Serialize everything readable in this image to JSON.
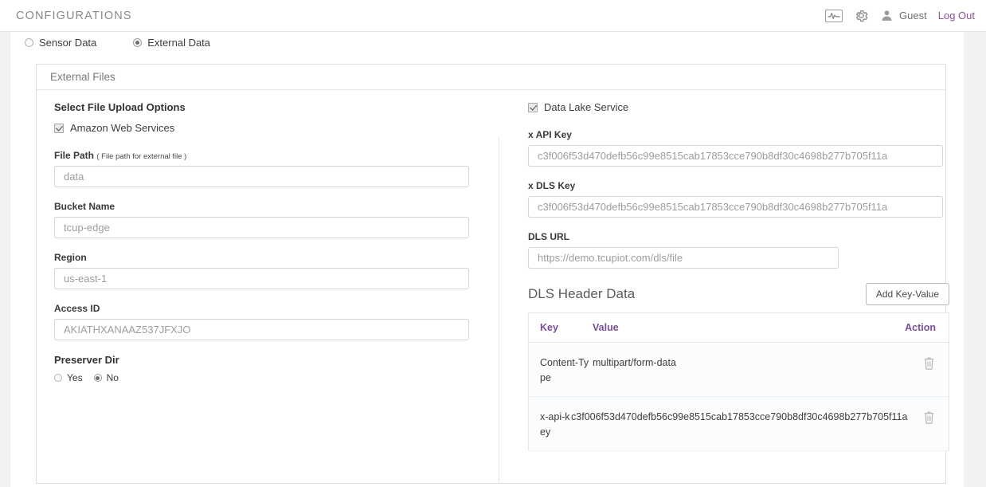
{
  "header": {
    "app_title": "CONFIGURATIONS",
    "monitor_icon": "monitor-waveform-icon",
    "gear_icon": "gear-icon",
    "avatar_icon": "user-avatar-icon",
    "user_name": "Guest",
    "logout_label": "Log Out",
    "logout_color": "#8b4f9e"
  },
  "data_source": {
    "options": [
      {
        "label": "Sensor Data",
        "selected": false
      },
      {
        "label": "External Data",
        "selected": true
      }
    ]
  },
  "card": {
    "title": "External Files"
  },
  "left": {
    "section_title": "Select File Upload Options",
    "aws_checkbox": {
      "label": "Amazon Web Services",
      "checked": true
    },
    "fields": [
      {
        "label": "File Path",
        "hint": "( File path for external file )",
        "value": "data"
      },
      {
        "label": "Bucket Name",
        "hint": "",
        "value": "tcup-edge"
      },
      {
        "label": "Region",
        "hint": "",
        "value": "us-east-1"
      },
      {
        "label": "Access ID",
        "hint": "",
        "value": "AKIATHXANAAZ537JFXJO"
      }
    ],
    "preserve_dir": {
      "label": "Preserver Dir",
      "options": [
        {
          "label": "Yes",
          "selected": false
        },
        {
          "label": "No",
          "selected": true
        }
      ]
    }
  },
  "right": {
    "dls_checkbox": {
      "label": "Data Lake Service",
      "checked": true
    },
    "fields": [
      {
        "label": "x API Key",
        "value": "c3f006f53d470defb56c99e8515cab17853cce790b8df30c4698b277b705f11a"
      },
      {
        "label": "x DLS Key",
        "value": "c3f006f53d470defb56c99e8515cab17853cce790b8df30c4698b277b705f11a"
      },
      {
        "label": "DLS URL",
        "value": "https://demo.tcupiot.com/dls/file"
      }
    ],
    "dls_header_data": {
      "title": "DLS Header Data",
      "add_button": "Add Key-Value",
      "columns": [
        "Key",
        "Value",
        "Action"
      ],
      "rows": [
        {
          "key": "Content-Type",
          "value": "multipart/form-data",
          "action_icon": "trash-icon"
        },
        {
          "key": "x-api-key",
          "value": "c3f006f53d470defb56c99e8515cab17853cce790b8df30c4698b277b705f11a",
          "action_icon": "trash-icon"
        }
      ]
    }
  },
  "colors": {
    "accent_purple": "#7b4f9b",
    "link_purple": "#8b4f9e",
    "page_bg": "#f2f2f2"
  }
}
